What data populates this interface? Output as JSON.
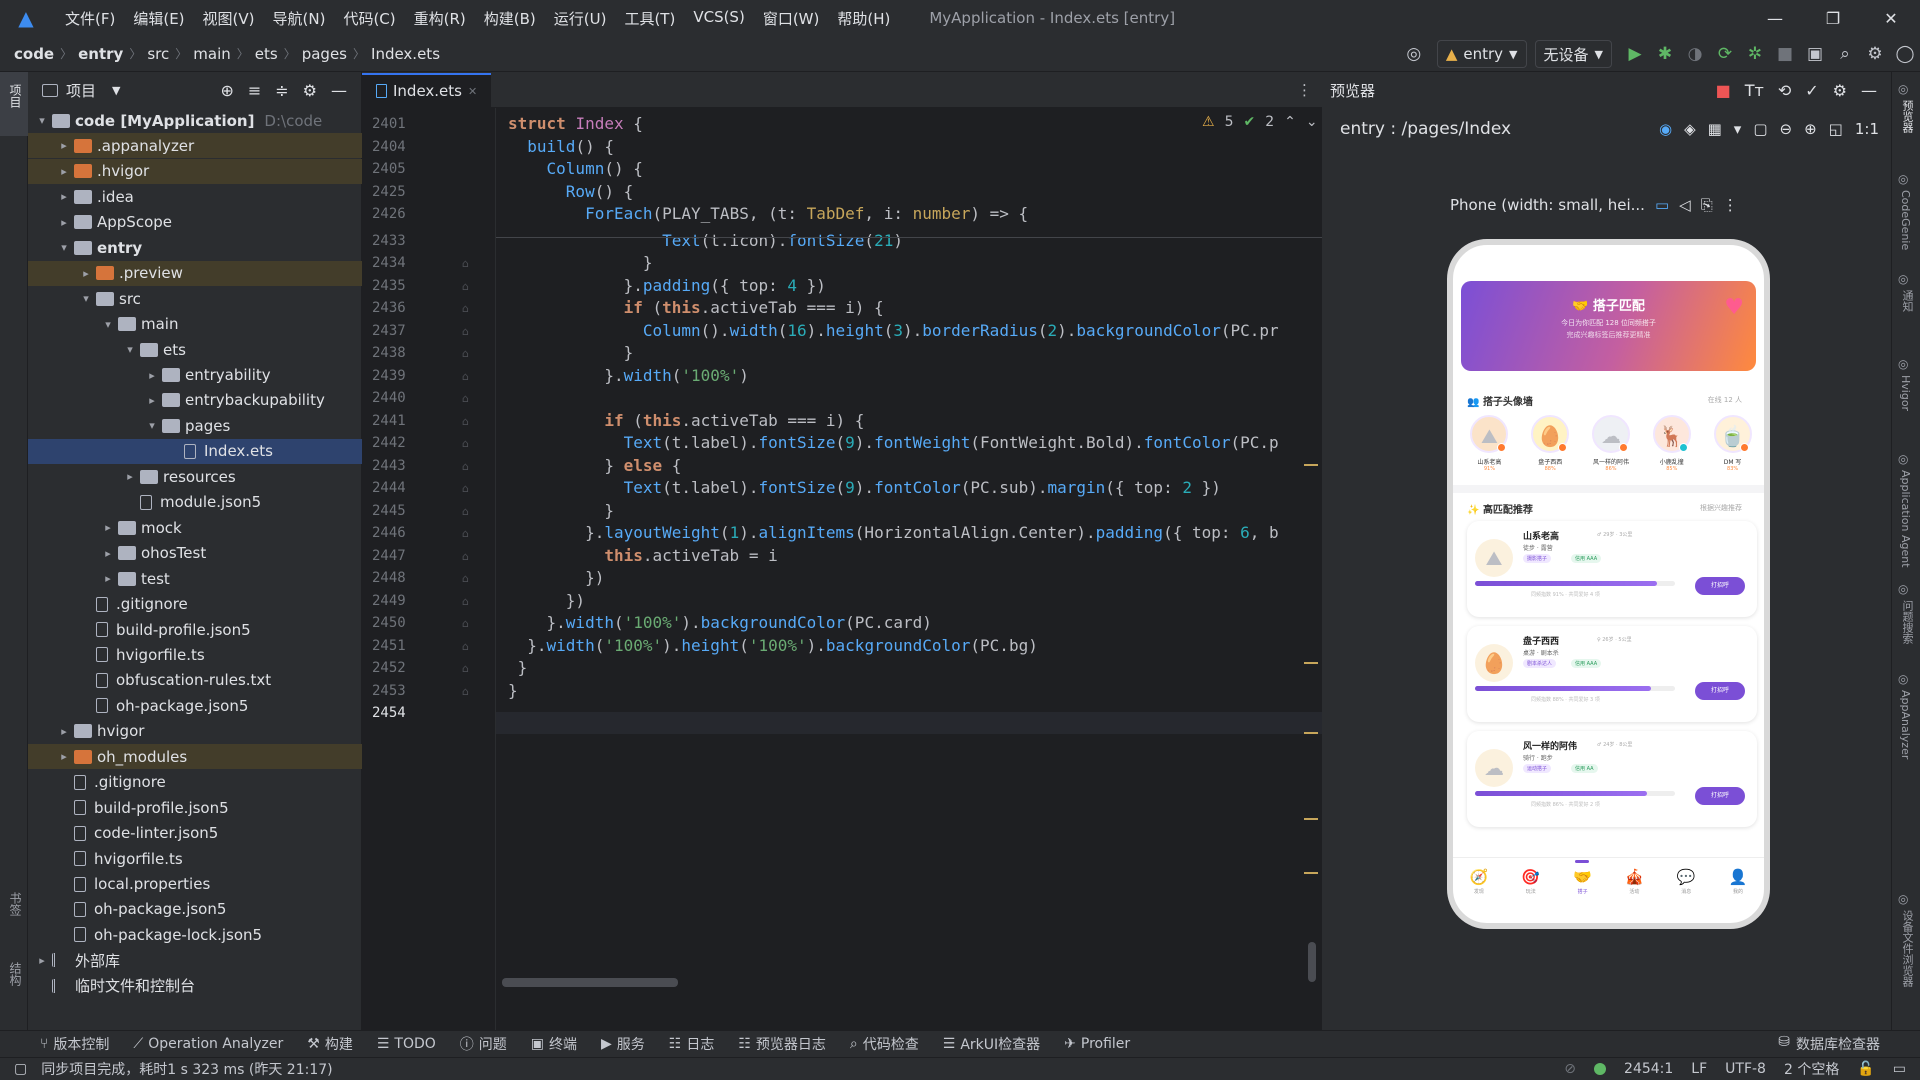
{
  "menu": {
    "items": [
      "文件(F)",
      "编辑(E)",
      "视图(V)",
      "导航(N)",
      "代码(C)",
      "重构(R)",
      "构建(B)",
      "运行(U)",
      "工具(T)",
      "VCS(S)",
      "窗口(W)",
      "帮助(H)"
    ],
    "title": "MyApplication - Index.ets [entry]"
  },
  "breadcrumb": [
    "code",
    "entry",
    "src",
    "main",
    "ets",
    "pages",
    "Index.ets"
  ],
  "toolbar": {
    "module": "entry",
    "device": "无设备"
  },
  "left_strip": {
    "project": "项目",
    "bookmarks": "书签",
    "structure": "结构"
  },
  "project": {
    "title": "项目",
    "rows": [
      {
        "label": "code [MyApplication]",
        "sub": "D:\\code",
        "depth": 0,
        "chev": "▾",
        "icon": "folder",
        "bold": true
      },
      {
        "label": ".appanalyzer",
        "depth": 1,
        "chev": "▸",
        "icon": "folder-or",
        "hl": true
      },
      {
        "label": ".hvigor",
        "depth": 1,
        "chev": "▸",
        "icon": "folder-or",
        "hl": true
      },
      {
        "label": ".idea",
        "depth": 1,
        "chev": "▸",
        "icon": "folder"
      },
      {
        "label": "AppScope",
        "depth": 1,
        "chev": "▸",
        "icon": "folder"
      },
      {
        "label": "entry",
        "depth": 1,
        "chev": "▾",
        "icon": "folder",
        "bold": true
      },
      {
        "label": ".preview",
        "depth": 2,
        "chev": "▸",
        "icon": "folder-or",
        "hl": true
      },
      {
        "label": "src",
        "depth": 2,
        "chev": "▾",
        "icon": "folder"
      },
      {
        "label": "main",
        "depth": 3,
        "chev": "▾",
        "icon": "folder"
      },
      {
        "label": "ets",
        "depth": 4,
        "chev": "▾",
        "icon": "folder"
      },
      {
        "label": "entryability",
        "depth": 5,
        "chev": "▸",
        "icon": "folder"
      },
      {
        "label": "entrybackupability",
        "depth": 5,
        "chev": "▸",
        "icon": "folder"
      },
      {
        "label": "pages",
        "depth": 5,
        "chev": "▾",
        "icon": "folder"
      },
      {
        "label": "Index.ets",
        "depth": 6,
        "chev": "",
        "icon": "file",
        "sel": true
      },
      {
        "label": "resources",
        "depth": 4,
        "chev": "▸",
        "icon": "folder"
      },
      {
        "label": "module.json5",
        "depth": 4,
        "chev": "",
        "icon": "file"
      },
      {
        "label": "mock",
        "depth": 3,
        "chev": "▸",
        "icon": "folder"
      },
      {
        "label": "ohosTest",
        "depth": 3,
        "chev": "▸",
        "icon": "folder"
      },
      {
        "label": "test",
        "depth": 3,
        "chev": "▸",
        "icon": "folder"
      },
      {
        "label": ".gitignore",
        "depth": 2,
        "chev": "",
        "icon": "file"
      },
      {
        "label": "build-profile.json5",
        "depth": 2,
        "chev": "",
        "icon": "file"
      },
      {
        "label": "hvigorfile.ts",
        "depth": 2,
        "chev": "",
        "icon": "file"
      },
      {
        "label": "obfuscation-rules.txt",
        "depth": 2,
        "chev": "",
        "icon": "file"
      },
      {
        "label": "oh-package.json5",
        "depth": 2,
        "chev": "",
        "icon": "file"
      },
      {
        "label": "hvigor",
        "depth": 1,
        "chev": "▸",
        "icon": "folder"
      },
      {
        "label": "oh_modules",
        "depth": 1,
        "chev": "▸",
        "icon": "folder-or",
        "hl": true
      },
      {
        "label": ".gitignore",
        "depth": 1,
        "chev": "",
        "icon": "file"
      },
      {
        "label": "build-profile.json5",
        "depth": 1,
        "chev": "",
        "icon": "file"
      },
      {
        "label": "code-linter.json5",
        "depth": 1,
        "chev": "",
        "icon": "file"
      },
      {
        "label": "hvigorfile.ts",
        "depth": 1,
        "chev": "",
        "icon": "file"
      },
      {
        "label": "local.properties",
        "depth": 1,
        "chev": "",
        "icon": "file"
      },
      {
        "label": "oh-package.json5",
        "depth": 1,
        "chev": "",
        "icon": "file"
      },
      {
        "label": "oh-package-lock.json5",
        "depth": 1,
        "chev": "",
        "icon": "file"
      },
      {
        "label": "外部库",
        "depth": 0,
        "chev": "▸",
        "icon": "lib"
      },
      {
        "label": "临时文件和控制台",
        "depth": 0,
        "chev": "",
        "icon": "lib"
      }
    ]
  },
  "editor": {
    "tab": "Index.ets",
    "inspections": {
      "warnings": "5",
      "ok": "2"
    },
    "lines": [
      {
        "n": "2401",
        "html": "<span class='kw'>struct</span> <span class='ty'>Index</span> {"
      },
      {
        "n": "2404",
        "html": "  <span class='fn'>build</span>() {"
      },
      {
        "n": "2405",
        "html": "    <span class='fn'>Column</span>() {"
      },
      {
        "n": "2425",
        "html": "      <span class='fn'>Row</span>() {"
      },
      {
        "n": "2426",
        "html": "        <span class='fn'>ForEach</span>(PLAY_TABS, (t: <span class='pr'>TabDef</span>, i: <span class='pr'>number</span>) => {"
      },
      {
        "n": "2433",
        "html": "                <span class='fn'>Text</span>(t.icon).<span class='fn'>fontSize</span>(<span class='nu'>21</span>)"
      },
      {
        "n": "2434",
        "html": "              }"
      },
      {
        "n": "2435",
        "html": "            }.<span class='fn'>padding</span>({ top: <span class='nu'>4</span> })"
      },
      {
        "n": "2436",
        "html": "            <span class='kw'>if</span> (<span class='kw'>this</span>.activeTab === i) {"
      },
      {
        "n": "2437",
        "html": "              <span class='fn'>Column</span>().<span class='fn'>width</span>(<span class='nu'>16</span>).<span class='fn'>height</span>(<span class='nu'>3</span>).<span class='fn'>borderRadius</span>(<span class='nu'>2</span>).<span class='fn'>backgroundColor</span>(PC.pr"
      },
      {
        "n": "2438",
        "html": "            }"
      },
      {
        "n": "2439",
        "html": "          }.<span class='fn'>width</span>(<span class='st'>'100%'</span>)"
      },
      {
        "n": "2440",
        "html": ""
      },
      {
        "n": "2441",
        "html": "          <span class='kw'>if</span> (<span class='kw'>this</span>.activeTab === i) {"
      },
      {
        "n": "2442",
        "html": "            <span class='fn'>Text</span>(t.label).<span class='fn'>fontSize</span>(<span class='nu'>9</span>).<span class='fn'>fontWeight</span>(FontWeight.Bold).<span class='fn'>fontColor</span>(PC.p"
      },
      {
        "n": "2443",
        "html": "          } <span class='kw'>else</span> {"
      },
      {
        "n": "2444",
        "html": "            <span class='fn'>Text</span>(t.label).<span class='fn'>fontSize</span>(<span class='nu'>9</span>).<span class='fn'>fontColor</span>(PC.sub).<span class='fn'>margin</span>({ top: <span class='nu'>2</span> })"
      },
      {
        "n": "2445",
        "html": "          }"
      },
      {
        "n": "2446",
        "html": "        }.<span class='fn'>layoutWeight</span>(<span class='nu'>1</span>).<span class='fn'>alignItems</span>(HorizontalAlign.Center).<span class='fn'>padding</span>({ top: <span class='nu'>6</span>, b"
      },
      {
        "n": "2447",
        "html": "          <span class='kw'>this</span>.activeTab = i"
      },
      {
        "n": "2448",
        "html": "        })"
      },
      {
        "n": "2449",
        "html": "      })"
      },
      {
        "n": "2450",
        "html": "    }.<span class='fn'>width</span>(<span class='st'>'100%'</span>).<span class='fn'>backgroundColor</span>(PC.card)"
      },
      {
        "n": "2451",
        "html": "  }.<span class='fn'>width</span>(<span class='st'>'100%'</span>).<span class='fn'>height</span>(<span class='st'>'100%'</span>).<span class='fn'>backgroundColor</span>(PC.bg)"
      },
      {
        "n": "2452",
        "html": " }"
      },
      {
        "n": "2453",
        "html": "}"
      },
      {
        "n": "2454",
        "html": ""
      }
    ]
  },
  "previewer": {
    "title": "预览器",
    "route": "entry : /pages/Index",
    "device": "Phone (width: small, hei...",
    "app": {
      "banner_title": "搭子匹配",
      "banner_sub1": "今日为你匹配 128 位同频搭子",
      "banner_sub2": "完成兴趣标签后推荐更精准",
      "wall_title": "搭子头像墙",
      "wall_count": "在线 12 人",
      "avatars": [
        {
          "name": "山系老高",
          "pct": "91%",
          "emoji": "⛰"
        },
        {
          "name": "盘子西西",
          "pct": "88%",
          "emoji": "🥚"
        },
        {
          "name": "风一样的阿伟",
          "pct": "86%",
          "emoji": "☁"
        },
        {
          "name": "小鹿乱撞",
          "pct": "85%",
          "emoji": "🦌"
        },
        {
          "name": "DM 写",
          "pct": "83%",
          "emoji": "🍵"
        }
      ],
      "rec_title": "高匹配推荐",
      "rec_more": "根据兴趣推荐",
      "cards": [
        {
          "name": "山系老高",
          "meta": "♂ 29岁 · 3公里",
          "tag1": "徒步 · 露营",
          "tag2": "摄影搭子",
          "tag3": "信用 AAA",
          "foot": "同频指数 91% · 共同爱好 4 项",
          "btn": "打招呼",
          "fill": 0.91,
          "emoji": "⛰"
        },
        {
          "name": "盘子西西",
          "meta": "♀ 26岁 · 5公里",
          "tag1": "桌游 · 剧本杀",
          "tag2": "剧本杀达人",
          "tag3": "信用 AAA",
          "foot": "同频指数 88% · 共同爱好 3 项",
          "btn": "打招呼",
          "fill": 0.88,
          "emoji": "🥚"
        },
        {
          "name": "风一样的阿伟",
          "meta": "♂ 24岁 · 8公里",
          "tag1": "骑行 · 跑步",
          "tag2": "运动搭子",
          "tag3": "信用 AA",
          "foot": "同频指数 86% · 共同爱好 2 项",
          "btn": "打招呼",
          "fill": 0.86,
          "emoji": "☁"
        }
      ],
      "nav": [
        {
          "label": "发现",
          "icon": "🧭"
        },
        {
          "label": "玩法",
          "icon": "🎯"
        },
        {
          "label": "搭子",
          "icon": "🤝"
        },
        {
          "label": "活动",
          "icon": "🎪"
        },
        {
          "label": "消息",
          "icon": "💬"
        },
        {
          "label": "我的",
          "icon": "👤"
        }
      ]
    }
  },
  "right_strip": [
    "预览器",
    "CodeGenie",
    "通知",
    "Hvigor",
    "Application Agent",
    "问题搜索",
    "AppAnalyzer",
    "设备文件浏览器"
  ],
  "bottom_tools": [
    "版本控制",
    "Operation Analyzer",
    "构建",
    "TODO",
    "问题",
    "终端",
    "服务",
    "日志",
    "预览器日志",
    "代码检查",
    "ArkUI检查器",
    "Profiler"
  ],
  "bottom_right": "数据库检查器",
  "status": {
    "message": "同步项目完成，耗时1 s 323 ms (昨天 21:17)",
    "position": "2454:1",
    "line_sep": "LF",
    "encoding": "UTF-8",
    "indent": "2 个空格"
  },
  "colors": {
    "accent": "#3574f0",
    "bg": "#1e1f22",
    "panel": "#2b2d30",
    "banner_from": "#7b4fd6",
    "banner_to": "#ff8a3d"
  }
}
